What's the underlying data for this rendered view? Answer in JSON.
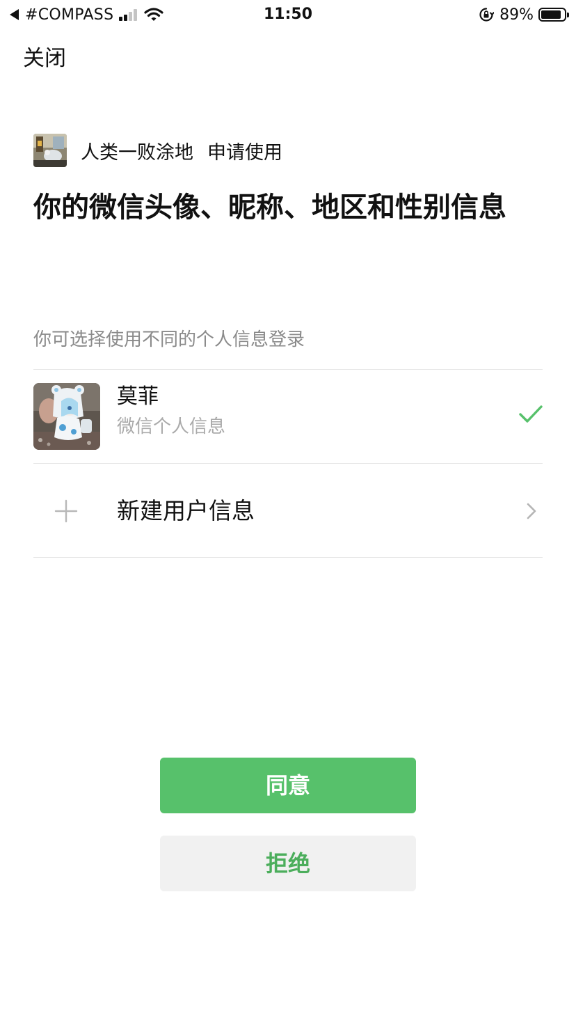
{
  "status_bar": {
    "carrier": "#COMPASS",
    "time": "11:50",
    "battery_percent": "89%",
    "battery_level": 0.89,
    "signal_bars_active": 2,
    "signal_bars_total": 4,
    "icons": [
      "back-triangle-icon",
      "signal-icon",
      "wifi-icon",
      "rotation-lock-icon",
      "battery-icon"
    ]
  },
  "nav": {
    "close_label": "关闭"
  },
  "request": {
    "app_name": "人类一败涂地",
    "request_label": "申请使用",
    "permission_title": "你的微信头像、昵称、地区和性别信息",
    "choose_hint": "你可选择使用不同的个人信息登录"
  },
  "accounts": [
    {
      "name": "莫菲",
      "subtitle": "微信个人信息",
      "selected": true
    }
  ],
  "new_profile": {
    "label": "新建用户信息"
  },
  "actions": {
    "agree_label": "同意",
    "reject_label": "拒绝"
  },
  "colors": {
    "accent_green": "#57c16b",
    "reject_text_green": "#4cae5c",
    "reject_bg": "#f1f1f1",
    "hint_gray": "#8a8a8a",
    "divider": "#e6e6e6"
  }
}
